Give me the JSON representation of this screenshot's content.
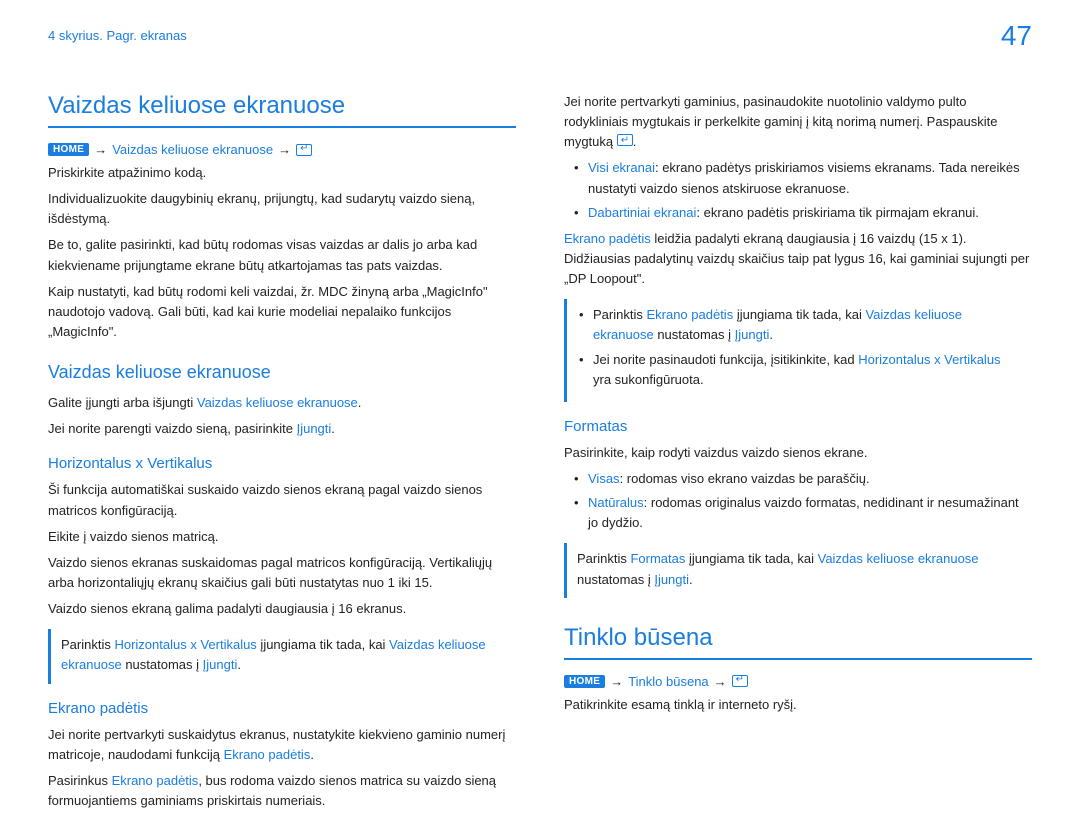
{
  "header": {
    "chapter": "4 skyrius. Pagr. ekranas",
    "page": "47"
  },
  "left": {
    "title": "Vaizdas keliuose ekranuose",
    "home": "HOME",
    "bc1": "Vaizdas keliuose ekranuose",
    "arrow": "→",
    "p1": "Priskirkite atpažinimo kodą.",
    "p2": "Individualizuokite daugybinių ekranų, prijungtų, kad sudarytų vaizdo sieną, išdėstymą.",
    "p3": "Be to, galite pasirinkti, kad būtų rodomas visas vaizdas ar dalis jo arba kad kiekviename prijungtame ekrane būtų atkartojamas tas pats vaizdas.",
    "p4": "Kaip nustatyti, kad būtų rodomi keli vaizdai, žr. MDC žinyną arba „MagicInfo\" naudotojo vadovą. Gali būti, kad kai kurie modeliai nepalaiko funkcijos „MagicInfo\".",
    "sub1": "Vaizdas keliuose ekranuose",
    "s1p1a": "Galite įjungti arba išjungti ",
    "s1p1b": "Vaizdas keliuose ekranuose",
    "s1p1c": ".",
    "s1p2a": "Jei norite parengti vaizdo sieną, pasirinkite ",
    "s1p2b": "Įjungti",
    "s1p2c": ".",
    "sub2": "Horizontalus x Vertikalus",
    "s2p1": "Ši funkcija automatiškai suskaido vaizdo sienos ekraną pagal vaizdo sienos matricos konfigūraciją.",
    "s2p2": "Eikite į vaizdo sienos matricą.",
    "s2p3": "Vaizdo sienos ekranas suskaidomas pagal matricos konfigūraciją. Vertikaliųjų arba horizontaliųjų ekranų skaičius gali būti nustatytas nuo 1 iki 15.",
    "s2p4": "Vaizdo sienos ekraną galima padalyti daugiausia į 16 ekranus.",
    "note1a": "Parinktis ",
    "note1b": "Horizontalus x Vertikalus",
    "note1c": " įjungiama tik tada, kai ",
    "note1d": "Vaizdas keliuose ekranuose",
    "note1e": " nustatomas į ",
    "note1f": "Įjungti",
    "note1g": ".",
    "sub3": "Ekrano padėtis",
    "s3p1a": "Jei norite pertvarkyti suskaidytus ekranus, nustatykite kiekvieno gaminio numerį matricoje, naudodami funkciją ",
    "s3p1b": "Ekrano padėtis",
    "s3p1c": ".",
    "s3p2a": "Pasirinkus ",
    "s3p2b": "Ekrano padėtis",
    "s3p2c": ", bus rodoma vaizdo sienos matrica su vaizdo sieną formuojantiems gaminiams priskirtais numeriais."
  },
  "right": {
    "rp1a": "Jei norite pertvarkyti gaminius, pasinaudokite nuotolinio valdymo pulto rodykliniais mygtukais ir perkelkite gaminį į kitą norimą numerį. Paspauskite mygtuką ",
    "rp1b": ".",
    "li1a": "Visi ekranai",
    "li1b": ": ekrano padėtys priskiriamos visiems ekranams. Tada nereikės nustatyti vaizdo sienos atskiruose ekranuose.",
    "li2a": "Dabartiniai ekranai",
    "li2b": ": ekrano padėtis priskiriama tik pirmajam ekranui.",
    "rp2a": "Ekrano padėtis",
    "rp2b": " leidžia padalyti ekraną daugiausia į 16 vaizdų (15 x 1). Didžiausias padalytinų vaizdų skaičius taip pat lygus 16, kai gaminiai sujungti per „DP Loopout\".",
    "n2li1a": "Parinktis ",
    "n2li1b": "Ekrano padėtis",
    "n2li1c": " įjungiama tik tada, kai ",
    "n2li1d": "Vaizdas keliuose ekranuose",
    "n2li1e": " nustatomas į ",
    "n2li1f": "Įjungti",
    "n2li1g": ".",
    "n2li2a": "Jei norite pasinaudoti funkcija, įsitikinkite, kad ",
    "n2li2b": "Horizontalus x Vertikalus",
    "n2li2c": " yra sukonfigūruota.",
    "sub4": "Formatas",
    "s4p1": "Pasirinkite, kaip rodyti vaizdus vaizdo sienos ekrane.",
    "s4li1a": "Visas",
    "s4li1b": ": rodomas viso ekrano vaizdas be paraščių.",
    "s4li2a": "Natūralus",
    "s4li2b": ": rodomas originalus vaizdo formatas, nedidinant ir nesumažinant jo dydžio.",
    "n3a": "Parinktis ",
    "n3b": "Formatas",
    "n3c": " įjungiama tik tada, kai ",
    "n3d": "Vaizdas keliuose ekranuose",
    "n3e": " nustatomas į ",
    "n3f": "Įjungti",
    "n3g": ".",
    "title2": "Tinklo būsena",
    "bc2": "Tinklo būsena",
    "t2p1": "Patikrinkite esamą tinklą ir interneto ryšį."
  }
}
